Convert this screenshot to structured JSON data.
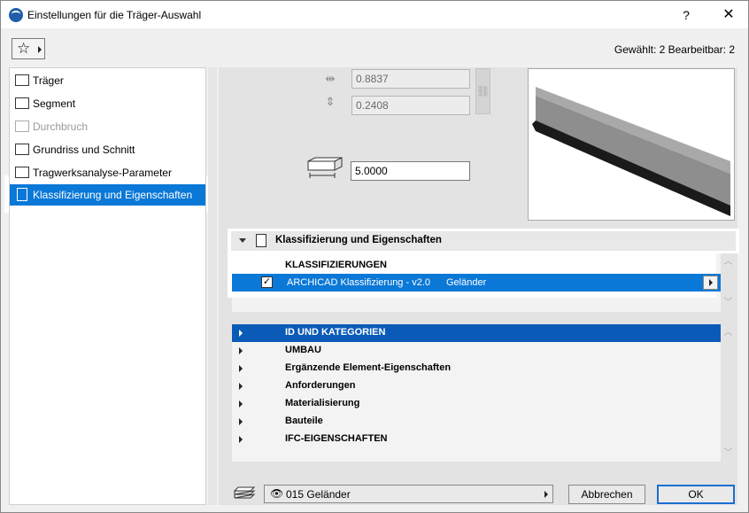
{
  "window": {
    "title": "Einstellungen für die Träger-Auswahl",
    "help_label": "?",
    "close_label": "✕"
  },
  "toolbar": {
    "selection_info": "Gewählt: 2 Bearbeitbar: 2"
  },
  "nav": {
    "items": [
      {
        "label": "Träger",
        "icon": "beam-icon",
        "state": "normal"
      },
      {
        "label": "Segment",
        "icon": "segment-icon",
        "state": "normal"
      },
      {
        "label": "Durchbruch",
        "icon": "hole-icon",
        "state": "disabled"
      },
      {
        "label": "Grundriss und Schnitt",
        "icon": "floorplan-icon",
        "state": "normal"
      },
      {
        "label": "Tragwerksanalyse-Parameter",
        "icon": "structural-analysis-icon",
        "state": "normal"
      },
      {
        "label": "Klassifizierung und Eigenschaften",
        "icon": "document-icon",
        "state": "selected"
      }
    ]
  },
  "geometry_fields": {
    "width_value": "0.8837",
    "height_value": "0.2408",
    "length_value": "5.0000"
  },
  "classification": {
    "section_title": "Klassifizierung und Eigenschaften",
    "heading": "KLASSIFIZIERUNGEN",
    "row": {
      "checked": true,
      "system": "ARCHICAD Klassifizierung - v2.0",
      "value": "Geländer"
    }
  },
  "properties": {
    "groups": [
      {
        "label": "ID UND KATEGORIEN",
        "selected": true
      },
      {
        "label": "UMBAU",
        "selected": false
      },
      {
        "label": "Ergänzende Element-Eigenschaften",
        "selected": false
      },
      {
        "label": "Anforderungen",
        "selected": false
      },
      {
        "label": "Materialisierung",
        "selected": false
      },
      {
        "label": "Bauteile",
        "selected": false
      },
      {
        "label": "IFC-EIGENSCHAFTEN",
        "selected": false
      }
    ]
  },
  "footer": {
    "layer_value": "015 Geländer",
    "cancel_label": "Abbrechen",
    "ok_label": "OK"
  },
  "colors": {
    "accent": "#0a78d7",
    "selected_group": "#0a5bb8"
  }
}
